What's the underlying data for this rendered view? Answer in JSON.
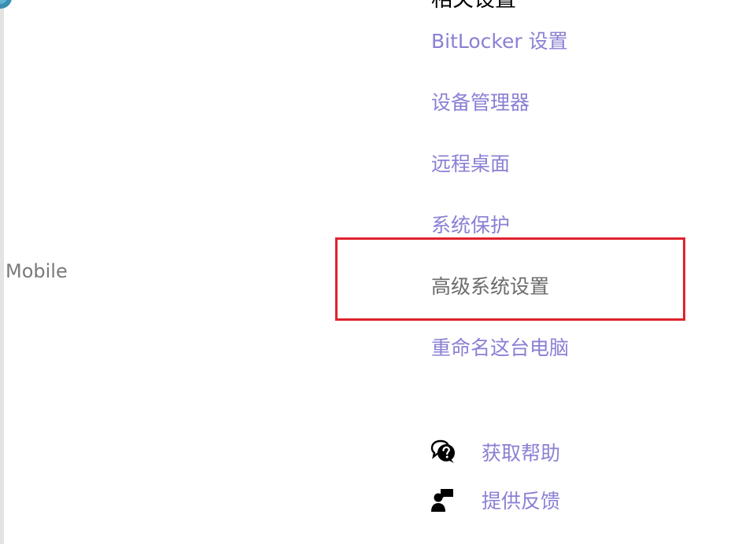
{
  "left_panel": {
    "mobile_text": "Mobile"
  },
  "related_settings": {
    "heading": "相关设置",
    "links": {
      "bitlocker": "BitLocker 设置",
      "device_manager": "设备管理器",
      "remote_desktop": "远程桌面",
      "system_protection": "系统保护",
      "advanced_system_settings": "高级系统设置",
      "rename_pc": "重命名这台电脑"
    }
  },
  "support": {
    "get_help": "获取帮助",
    "feedback": "提供反馈"
  },
  "icons": {
    "corner": "app-icon",
    "help": "chat-question-icon",
    "feedback": "person-feedback-icon"
  },
  "colors": {
    "link": "#8a80d4",
    "highlight": "#e0232e",
    "plain_text": "#6b6b6b"
  }
}
